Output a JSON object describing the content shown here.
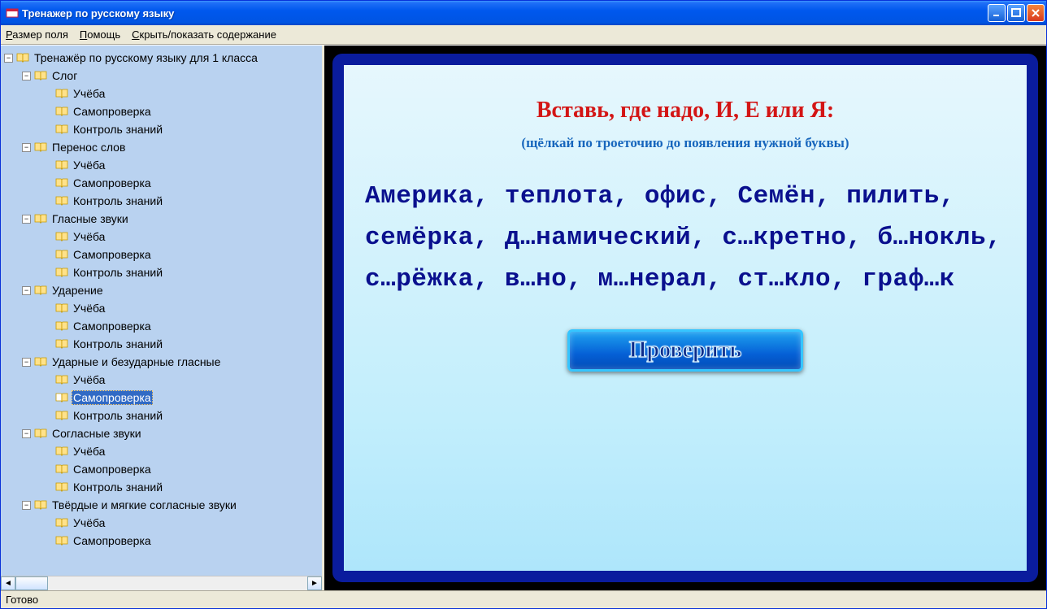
{
  "window": {
    "title": "Тренажер по русскому языку"
  },
  "menu": {
    "field_size": "Размер поля",
    "help": "Помощь",
    "toggle_toc": "Скрыть/показать содержание"
  },
  "tree": {
    "root": "Тренажёр по русскому языку для 1 класса",
    "topics": [
      {
        "name": "Слог",
        "children": [
          "Учёба",
          "Самопроверка",
          "Контроль знаний"
        ]
      },
      {
        "name": "Перенос слов",
        "children": [
          "Учёба",
          "Самопроверка",
          "Контроль знаний"
        ]
      },
      {
        "name": "Гласные звуки",
        "children": [
          "Учёба",
          "Самопроверка",
          "Контроль знаний"
        ]
      },
      {
        "name": "Ударение",
        "children": [
          "Учёба",
          "Самопроверка",
          "Контроль знаний"
        ]
      },
      {
        "name": "Ударные и безударные гласные",
        "children": [
          "Учёба",
          "Самопроверка",
          "Контроль знаний"
        ],
        "selected_child": 1
      },
      {
        "name": "Согласные звуки",
        "children": [
          "Учёба",
          "Самопроверка",
          "Контроль знаний"
        ]
      },
      {
        "name": "Твёрдые и мягкие согласные звуки",
        "children": [
          "Учёба",
          "Самопроверка"
        ]
      }
    ]
  },
  "exercise": {
    "title": "Вставь, где надо, И, Е или Я:",
    "subtitle": "(щёлкай по троеточию до появления нужной буквы)",
    "words_text": "Америка, теплота, офис, Семён, пилить, семёрка, д…намический, с…кретно, б…нокль, с…рёжка, в…но, м…нерал, ст…кло, граф…к",
    "check_label": "Проверить"
  },
  "status": {
    "text": "Готово"
  }
}
